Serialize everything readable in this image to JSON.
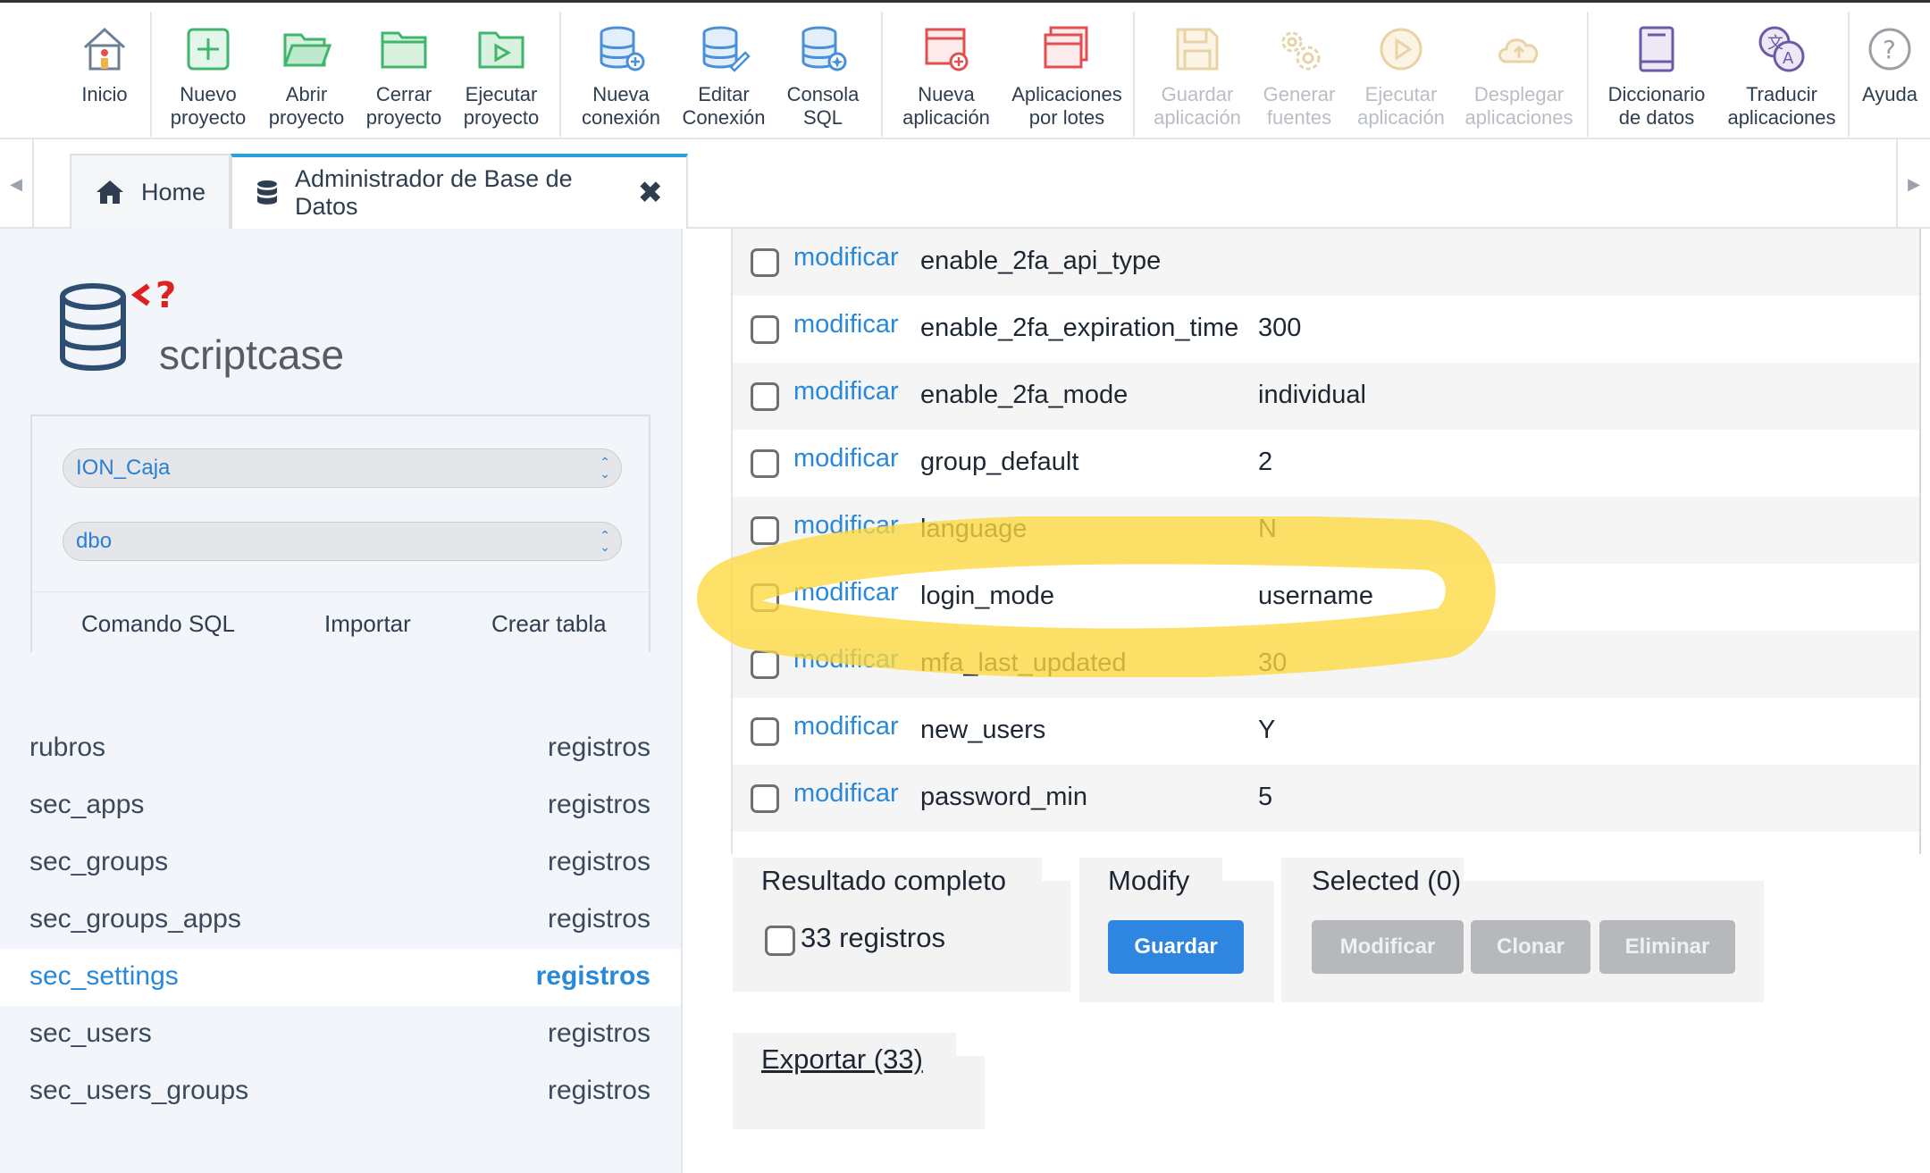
{
  "toolbar": {
    "buttons": [
      {
        "label": "Inicio",
        "icon": "home-icon"
      },
      {
        "label": "Nuevo\nproyecto",
        "icon": "new-project-icon"
      },
      {
        "label": "Abrir\nproyecto",
        "icon": "folder-open-icon"
      },
      {
        "label": "Cerrar\nproyecto",
        "icon": "folder-icon"
      },
      {
        "label": "Ejecutar\nproyecto",
        "icon": "folder-play-icon"
      },
      {
        "label": "Nueva\nconexión",
        "icon": "database-add-icon"
      },
      {
        "label": "Editar\nConexión",
        "icon": "database-edit-icon"
      },
      {
        "label": "Consola\nSQL",
        "icon": "database-console-icon"
      },
      {
        "label": "Nueva\naplicación",
        "icon": "new-app-icon"
      },
      {
        "label": "Aplicaciones\npor lotes",
        "icon": "batch-apps-icon"
      },
      {
        "label": "Guardar\naplicación",
        "icon": "save-icon"
      },
      {
        "label": "Generar\nfuentes",
        "icon": "gears-icon"
      },
      {
        "label": "Ejecutar\naplicación",
        "icon": "play-icon"
      },
      {
        "label": "Desplegar\naplicaciones",
        "icon": "cloud-upload-icon"
      },
      {
        "label": "Diccionario\nde datos",
        "icon": "dictionary-icon"
      },
      {
        "label": "Traducir\naplicaciones",
        "icon": "translate-icon"
      },
      {
        "label": "Ayuda",
        "icon": "help-icon"
      }
    ]
  },
  "tabs": [
    {
      "label": "Home",
      "icon": "home-icon"
    },
    {
      "label": "Administrador de Base de Datos",
      "icon": "database-icon"
    }
  ],
  "sidebar": {
    "brand": "scriptcase",
    "connection": "ION_Caja",
    "schema": "dbo",
    "links": [
      "Comando SQL",
      "Importar",
      "Crear tabla"
    ],
    "tables": [
      {
        "name": "rubros",
        "action": "registros"
      },
      {
        "name": "sec_apps",
        "action": "registros"
      },
      {
        "name": "sec_groups",
        "action": "registros"
      },
      {
        "name": "sec_groups_apps",
        "action": "registros"
      },
      {
        "name": "sec_settings",
        "action": "registros"
      },
      {
        "name": "sec_users",
        "action": "registros"
      },
      {
        "name": "sec_users_groups",
        "action": "registros"
      }
    ]
  },
  "grid": {
    "action_label": "modificar",
    "rows": [
      {
        "key": "enable_2fa_api_type",
        "value": ""
      },
      {
        "key": "enable_2fa_expiration_time",
        "value": "300"
      },
      {
        "key": "enable_2fa_mode",
        "value": "individual"
      },
      {
        "key": "group_default",
        "value": "2"
      },
      {
        "key": "language",
        "value": "N"
      },
      {
        "key": "login_mode",
        "value": "username"
      },
      {
        "key": "mfa_last_updated",
        "value": "30"
      },
      {
        "key": "new_users",
        "value": "Y"
      },
      {
        "key": "password_min",
        "value": "5"
      }
    ]
  },
  "bottom": {
    "result_title": "Resultado completo",
    "result_count": "33 registros",
    "modify_title": "Modify",
    "save_label": "Guardar",
    "selected_title": "Selected (0)",
    "modificar_label": "Modificar",
    "clonar_label": "Clonar",
    "eliminar_label": "Eliminar",
    "export_label": "Exportar (33)"
  },
  "colors": {
    "accent": "#2a88d8",
    "primary_button": "#2f86e0",
    "highlight": "#fcd93e"
  }
}
